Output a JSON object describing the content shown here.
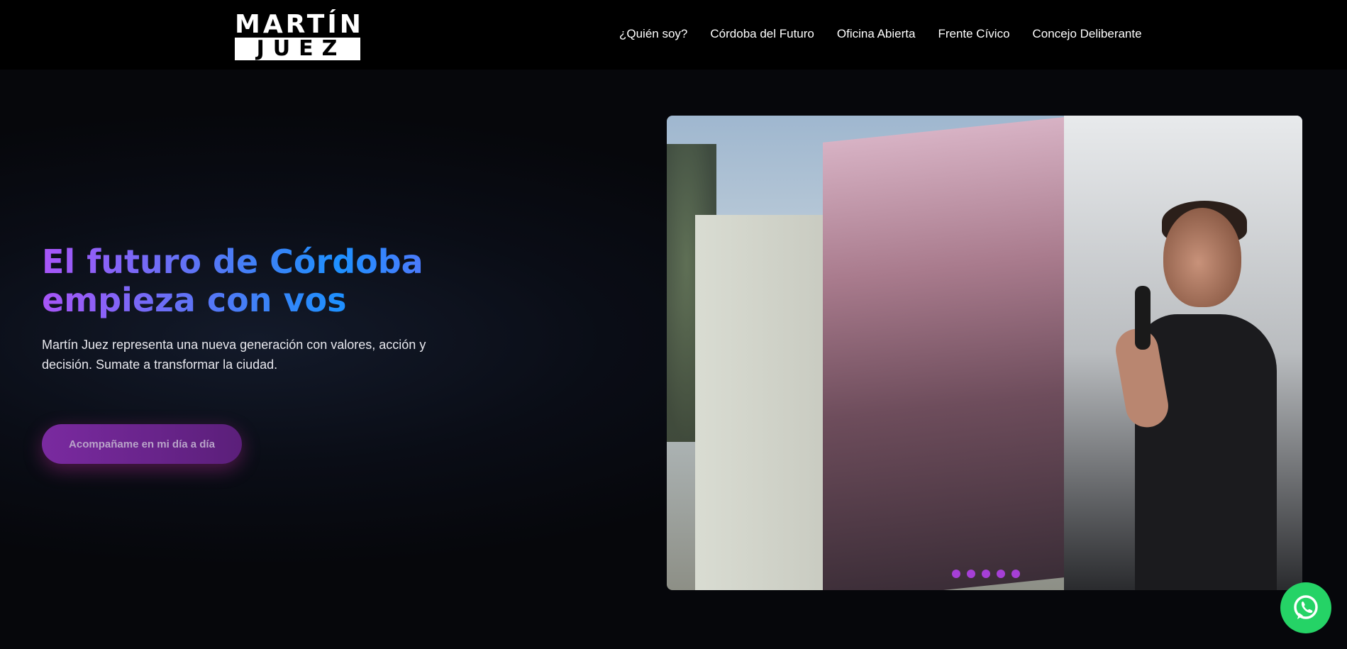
{
  "brand": {
    "logo_line1": "MARTÍN",
    "logo_line2": "JUEZ"
  },
  "nav": {
    "items": [
      {
        "label": "¿Quién soy?"
      },
      {
        "label": "Córdoba del Futuro"
      },
      {
        "label": "Oficina Abierta"
      },
      {
        "label": "Frente Cívico"
      },
      {
        "label": "Concejo Deliberante"
      }
    ]
  },
  "hero": {
    "headline_line1": "El futuro de Córdoba",
    "headline_line2": "empieza con vos",
    "subtitle": "Martín Juez representa una nueva generación con valores, acción y decisión. Sumate a transformar la ciudad.",
    "cta_label": "Acompañame en mi día a día"
  },
  "slider": {
    "slide_count": 5,
    "dot_color": "#a63fd6"
  },
  "colors": {
    "accent_purple": "#a855f7",
    "accent_blue": "#3b82f6",
    "whatsapp_green": "#25d366",
    "background": "#07080d"
  },
  "icons": {
    "whatsapp": "whatsapp-icon"
  }
}
